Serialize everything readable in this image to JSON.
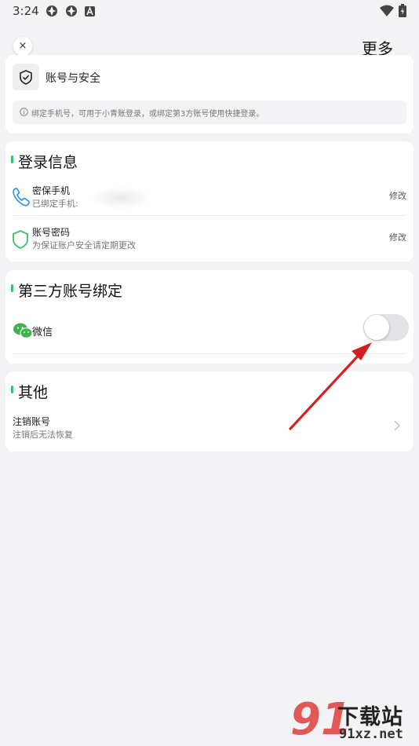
{
  "status_bar": {
    "time": "3:24"
  },
  "header": {
    "close_label": "×",
    "more_label": "更多"
  },
  "security_card": {
    "title": "账号与安全",
    "notice": "绑定手机号，可用于小青账登录，或绑定第3方账号使用快捷登录。"
  },
  "login_info": {
    "heading": "登录信息",
    "phone": {
      "title": "密保手机",
      "subtitle": "已绑定手机:",
      "action": "修改"
    },
    "password": {
      "title": "账号密码",
      "subtitle": "为保证账户安全请定期更改",
      "action": "修改"
    }
  },
  "third_party": {
    "heading": "第三方账号绑定",
    "wechat": {
      "label": "微信",
      "enabled": false
    }
  },
  "other": {
    "heading": "其他",
    "cancel_account": {
      "title": "注销账号",
      "subtitle": "注销后无法恢复"
    }
  },
  "watermark": {
    "brand": "下载站",
    "url": "91xz.net"
  },
  "colors": {
    "accent_green": "#39c16c",
    "wechat_green": "#3fb34f",
    "phone_blue": "#2f8fe0",
    "arrow_red": "#d32020"
  }
}
